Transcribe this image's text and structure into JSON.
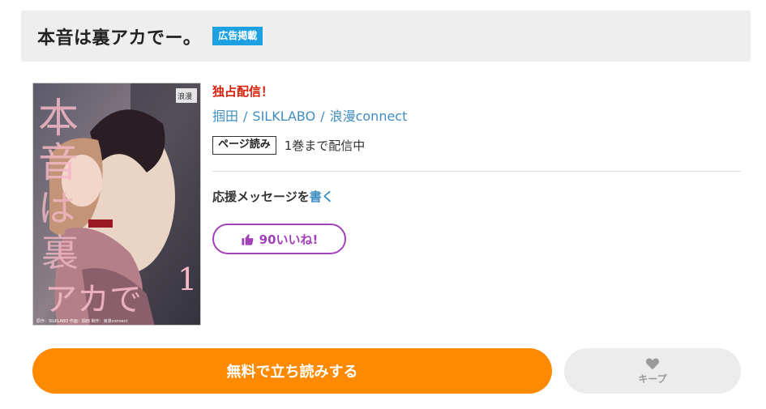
{
  "header": {
    "title": "本音は裏アカでー。",
    "ad_badge": "広告掲載"
  },
  "cover": {
    "alt_title": "本音は裏アカでー。",
    "volume_mark": "1",
    "credit_line": "原作：SILKLABO 作画：掴田 制作：浪漫connect",
    "logo_text": "浪漫"
  },
  "info": {
    "exclusive_label": "独占配信！",
    "authors": [
      "掴田",
      "SILKLABO",
      "浪漫connect"
    ],
    "author_separator": "/",
    "format_tag": "ページ読み",
    "volume_status": "1巻まで配信中",
    "support_prefix": "応援メッセージを",
    "support_link": "書く",
    "like_label": "90いいね!"
  },
  "actions": {
    "read_label": "無料で立ち読みする",
    "keep_label": "キープ"
  },
  "colors": {
    "accent_orange": "#ff8a00",
    "exclusive_red": "#d81e0a",
    "link_blue": "#3f8dbf",
    "like_purple": "#a341b8",
    "ad_blue": "#1ea1e3"
  }
}
